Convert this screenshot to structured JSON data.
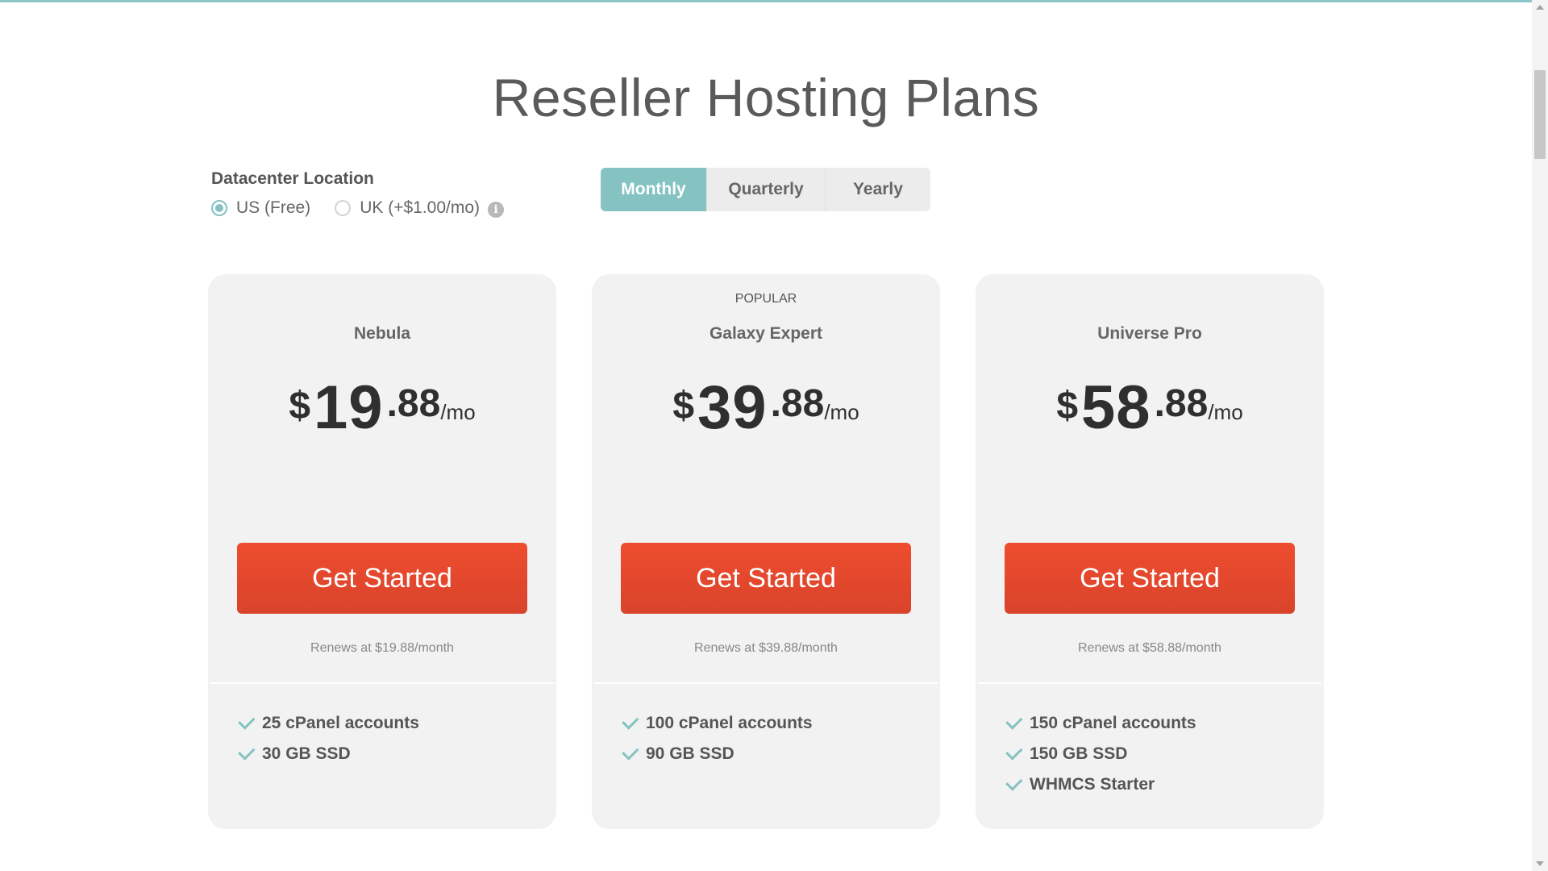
{
  "page": {
    "title": "Reseller Hosting Plans"
  },
  "datacenter": {
    "label": "Datacenter Location",
    "options": [
      {
        "label": "US (Free)",
        "selected": true
      },
      {
        "label": "UK (+$1.00/mo)",
        "selected": false,
        "info_icon": "info-icon"
      }
    ]
  },
  "billing": {
    "tabs": [
      "Monthly",
      "Quarterly",
      "Yearly"
    ],
    "active": "Monthly"
  },
  "plans": [
    {
      "badge": "",
      "name": "Nebula",
      "currency": "$",
      "price_whole": "19",
      "price_cents": ".88",
      "price_unit": "/mo",
      "cta": "Get Started",
      "renews": "Renews at $19.88/month",
      "features": [
        "25 cPanel accounts",
        "30 GB SSD"
      ]
    },
    {
      "badge": "POPULAR",
      "name": "Galaxy Expert",
      "currency": "$",
      "price_whole": "39",
      "price_cents": ".88",
      "price_unit": "/mo",
      "cta": "Get Started",
      "renews": "Renews at $39.88/month",
      "features": [
        "100 cPanel accounts",
        "90 GB SSD"
      ]
    },
    {
      "badge": "",
      "name": "Universe Pro",
      "currency": "$",
      "price_whole": "58",
      "price_cents": ".88",
      "price_unit": "/mo",
      "cta": "Get Started",
      "renews": "Renews at $58.88/month",
      "features": [
        "150 cPanel accounts",
        "150 GB SSD",
        "WHMCS Starter"
      ]
    }
  ],
  "colors": {
    "accent": "#85c2c2",
    "cta": "#e8472d",
    "card_bg": "#f2f2f2"
  }
}
